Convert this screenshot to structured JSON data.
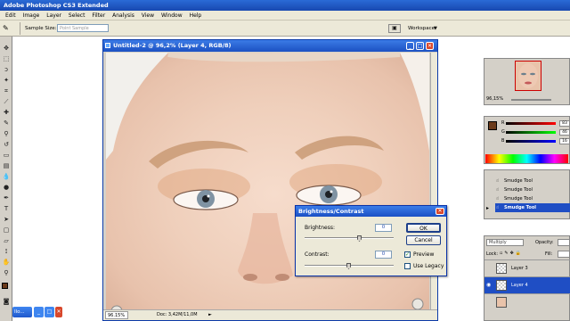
{
  "app": {
    "title": "Adobe Photoshop CS3 Extended"
  },
  "menu": [
    "Edit",
    "Image",
    "Layer",
    "Select",
    "Filter",
    "Analysis",
    "View",
    "Window",
    "Help"
  ],
  "options_bar": {
    "sample_size_label": "Sample Size:",
    "sample_size_value": "Point Sample",
    "workspace_label": "Workspace"
  },
  "document": {
    "title": "Untitled-2 @ 96,2% (Layer 4, RGB/8)",
    "zoom": "96.15%",
    "doc_info": "Doc: 3,42M/11,0M"
  },
  "dialog": {
    "title": "Brightness/Contrast",
    "brightness_label": "Brightness:",
    "brightness_value": "0",
    "brightness_level": 0.62,
    "contrast_label": "Contrast:",
    "contrast_value": "0",
    "contrast_level": 0.5,
    "ok_label": "OK",
    "cancel_label": "Cancel",
    "preview_label": "Preview",
    "preview_checked": true,
    "legacy_label": "Use Legacy",
    "legacy_checked": false
  },
  "navigator": {
    "zoom": "96,15%"
  },
  "color_panel": {
    "channels": [
      {
        "label": "R",
        "value": "83",
        "color": "#cc3333"
      },
      {
        "label": "G",
        "value": "46",
        "color": "#33aa33"
      },
      {
        "label": "B",
        "value": "16",
        "color": "#3355cc"
      }
    ],
    "fg_color": "#6b3a1a"
  },
  "history": {
    "items": [
      "Smudge Tool",
      "Smudge Tool",
      "Smudge Tool",
      "Smudge Tool"
    ],
    "active_index": 3
  },
  "layers": {
    "blend_mode": "Multiply",
    "opacity_label": "Opacity:",
    "lock_label": "Lock:",
    "fill_label": "Fill:",
    "items": [
      {
        "name": "Layer 3",
        "active": false
      },
      {
        "name": "Layer 4",
        "active": true
      }
    ]
  },
  "taskbar": {
    "button_label": "Ilo..."
  }
}
